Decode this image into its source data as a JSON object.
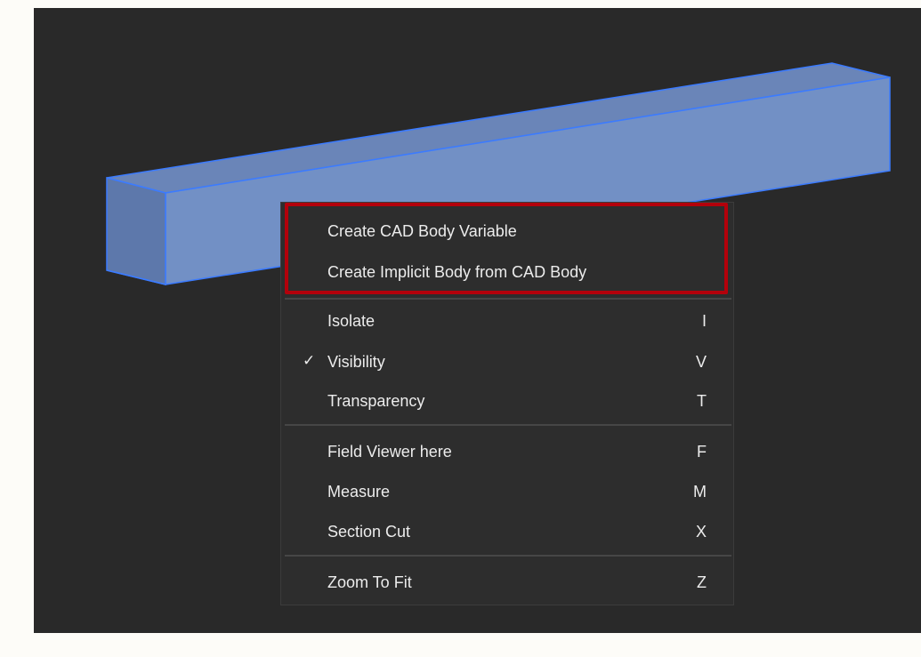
{
  "menu": {
    "items": [
      {
        "label": "Create CAD Body Variable",
        "shortcut": "",
        "checked": false
      },
      {
        "label": "Create Implicit Body from CAD Body",
        "shortcut": "",
        "checked": false
      },
      {
        "label": "Isolate",
        "shortcut": "I",
        "checked": false
      },
      {
        "label": "Visibility",
        "shortcut": "V",
        "checked": true,
        "check_mark": "✓"
      },
      {
        "label": "Transparency",
        "shortcut": "T",
        "checked": false
      },
      {
        "label": "Field Viewer here",
        "shortcut": "F",
        "checked": false
      },
      {
        "label": "Measure",
        "shortcut": "M",
        "checked": false
      },
      {
        "label": "Section Cut",
        "shortcut": "X",
        "checked": false
      },
      {
        "label": "Zoom To Fit",
        "shortcut": "Z",
        "checked": false
      }
    ]
  },
  "colors": {
    "viewport_background": "#292929",
    "body_front_face": "#6f8fc4",
    "body_end_face": "#5a74a8",
    "body_edge": "#3b7bff",
    "highlight_border": "#b3000b",
    "menu_background": "#2d2d2d",
    "menu_text": "#ececec"
  }
}
